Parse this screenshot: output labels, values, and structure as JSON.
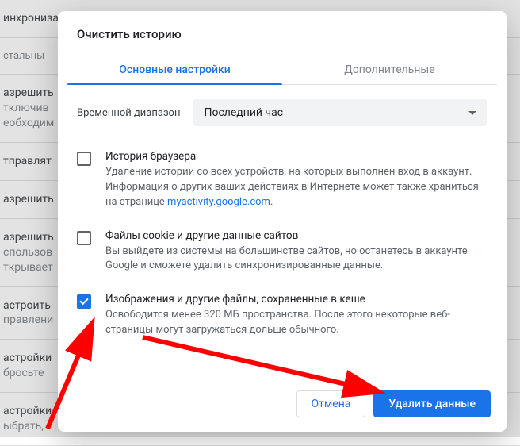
{
  "bg": {
    "items": [
      "инхронизация сервисов Google",
      "стальны",
      "азрешить",
      "тключив",
      "еобходим",
      "тправлят",
      "азрешить",
      "азрешить",
      "спользов",
      "ткрывает",
      "астроить",
      "правлени",
      "астройки",
      "бросьте",
      "астройки",
      "ыбрать,"
    ]
  },
  "dialog": {
    "title": "Очистить историю",
    "tabs": {
      "basic": "Основные настройки",
      "advanced": "Дополнительные"
    },
    "timerange": {
      "label": "Временной диапазон",
      "selected": "Последний час"
    },
    "items": [
      {
        "title": "История браузера",
        "desc_pre": "Удаление истории со всех устройств, на которых выполнен вход в аккаунт. Информация о других ваших действиях в Интернете может также храниться на странице ",
        "link": "myactivity.google.com",
        "desc_post": ".",
        "checked": false
      },
      {
        "title": "Файлы cookie и другие данные сайтов",
        "desc_pre": "Вы выйдете из системы на большинстве сайтов, но останетесь в аккаунте Google и сможете удалить синхронизированные данные.",
        "link": "",
        "desc_post": "",
        "checked": false
      },
      {
        "title": "Изображения и другие файлы, сохраненные в кеше",
        "desc_pre": "Освободится менее 320 МБ пространства. После этого некоторые веб-страницы могут загружаться дольше обычного.",
        "link": "",
        "desc_post": "",
        "checked": true
      }
    ],
    "cancel": "Отмена",
    "confirm": "Удалить данные"
  }
}
